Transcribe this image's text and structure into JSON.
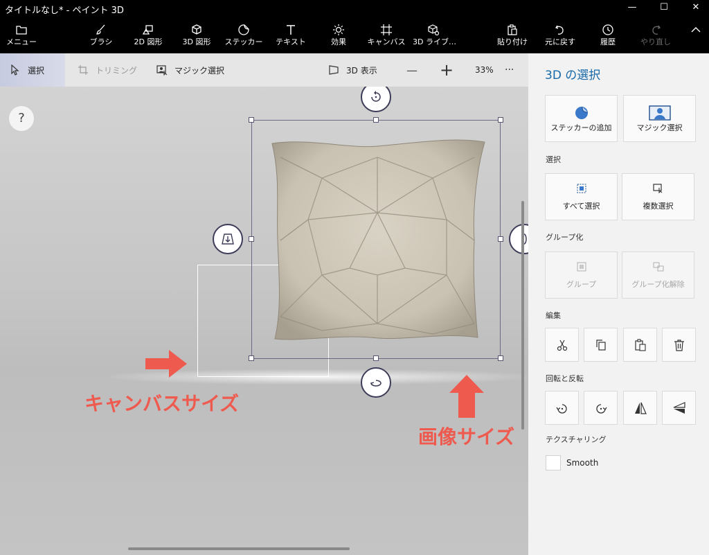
{
  "window": {
    "title": "タイトルなし* - ペイント 3D",
    "minimize": "—",
    "maximize": "☐",
    "close": "✕"
  },
  "ribbon": {
    "menu": "メニュー",
    "brush": "ブラシ",
    "shapes2d": "2D 図形",
    "shapes3d": "3D 図形",
    "stickers": "ステッカー",
    "text": "テキスト",
    "effects": "効果",
    "canvas": "キャンバス",
    "library3d": "3D ライブ…",
    "paste": "貼り付け",
    "undo": "元に戻す",
    "history": "履歴",
    "redo": "やり直し",
    "collapse": "^"
  },
  "subbar": {
    "select": "選択",
    "crop": "トリミング",
    "magic_select": "マジック選択",
    "view3d": "3D 表示",
    "zoom_out": "—",
    "zoom_in": "+",
    "zoom_level": "33%",
    "more": "···"
  },
  "canvas": {
    "help": "?",
    "canvas_size_label": "キャンバスサイズ",
    "image_size_label": "画像サイズ"
  },
  "panel": {
    "title": "3D の選択",
    "add_sticker": "ステッカーの追加",
    "magic_select": "マジック選択",
    "section_select": "選択",
    "select_all": "すべて選択",
    "multi_select": "複数選択",
    "section_group": "グループ化",
    "group": "グループ",
    "ungroup": "グループ化解除",
    "section_edit": "編集",
    "section_rotate": "回転と反転",
    "section_texture": "テクスチャリング",
    "smooth": "Smooth"
  },
  "colors": {
    "accent": "#1769aa",
    "annotation": "#ef5a4f"
  }
}
